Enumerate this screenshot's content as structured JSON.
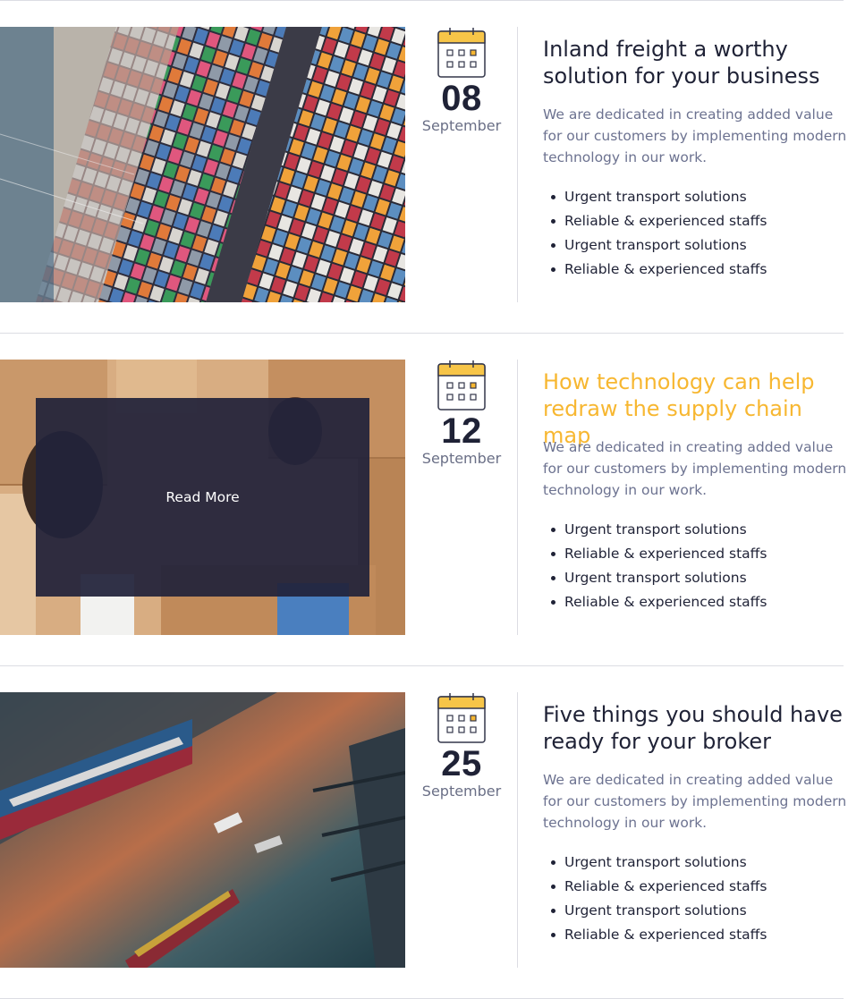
{
  "posts": [
    {
      "day": "08",
      "month": "September",
      "title": "Inland freight a worthy solution for your business",
      "description": "We are dedicated in creating added value for our customers by implementing modern technology in our work.",
      "bullets": [
        "Urgent transport solutions",
        "Reliable & experienced staffs",
        "Urgent transport solutions",
        "Reliable & experienced staffs"
      ],
      "image": "container-yard-aerial-photo"
    },
    {
      "day": "12",
      "month": "September",
      "title": "How technology can help redraw the supply chain map",
      "description": "We are dedicated in creating added value for our customers by implementing modern technology in our work.",
      "bullets": [
        "Urgent transport solutions",
        "Reliable & experienced staffs",
        "Urgent transport solutions",
        "Reliable & experienced staffs"
      ],
      "image": "people-with-boxes-photo",
      "overlay_label": "Read More"
    },
    {
      "day": "25",
      "month": "September",
      "title": "Five things you should have ready for your broker",
      "description": "We are dedicated in creating added value for our customers by implementing modern technology in our work.",
      "bullets": [
        "Urgent transport solutions",
        "Reliable & experienced staffs",
        "Urgent transport solutions",
        "Reliable & experienced staffs"
      ],
      "image": "cargo-port-ships-photo"
    }
  ],
  "icons": {
    "calendar": "calendar-icon"
  },
  "colors": {
    "accent": "#f7b731",
    "text": "#1f2236",
    "muted": "#6c7290",
    "overlay": "#21223a"
  }
}
